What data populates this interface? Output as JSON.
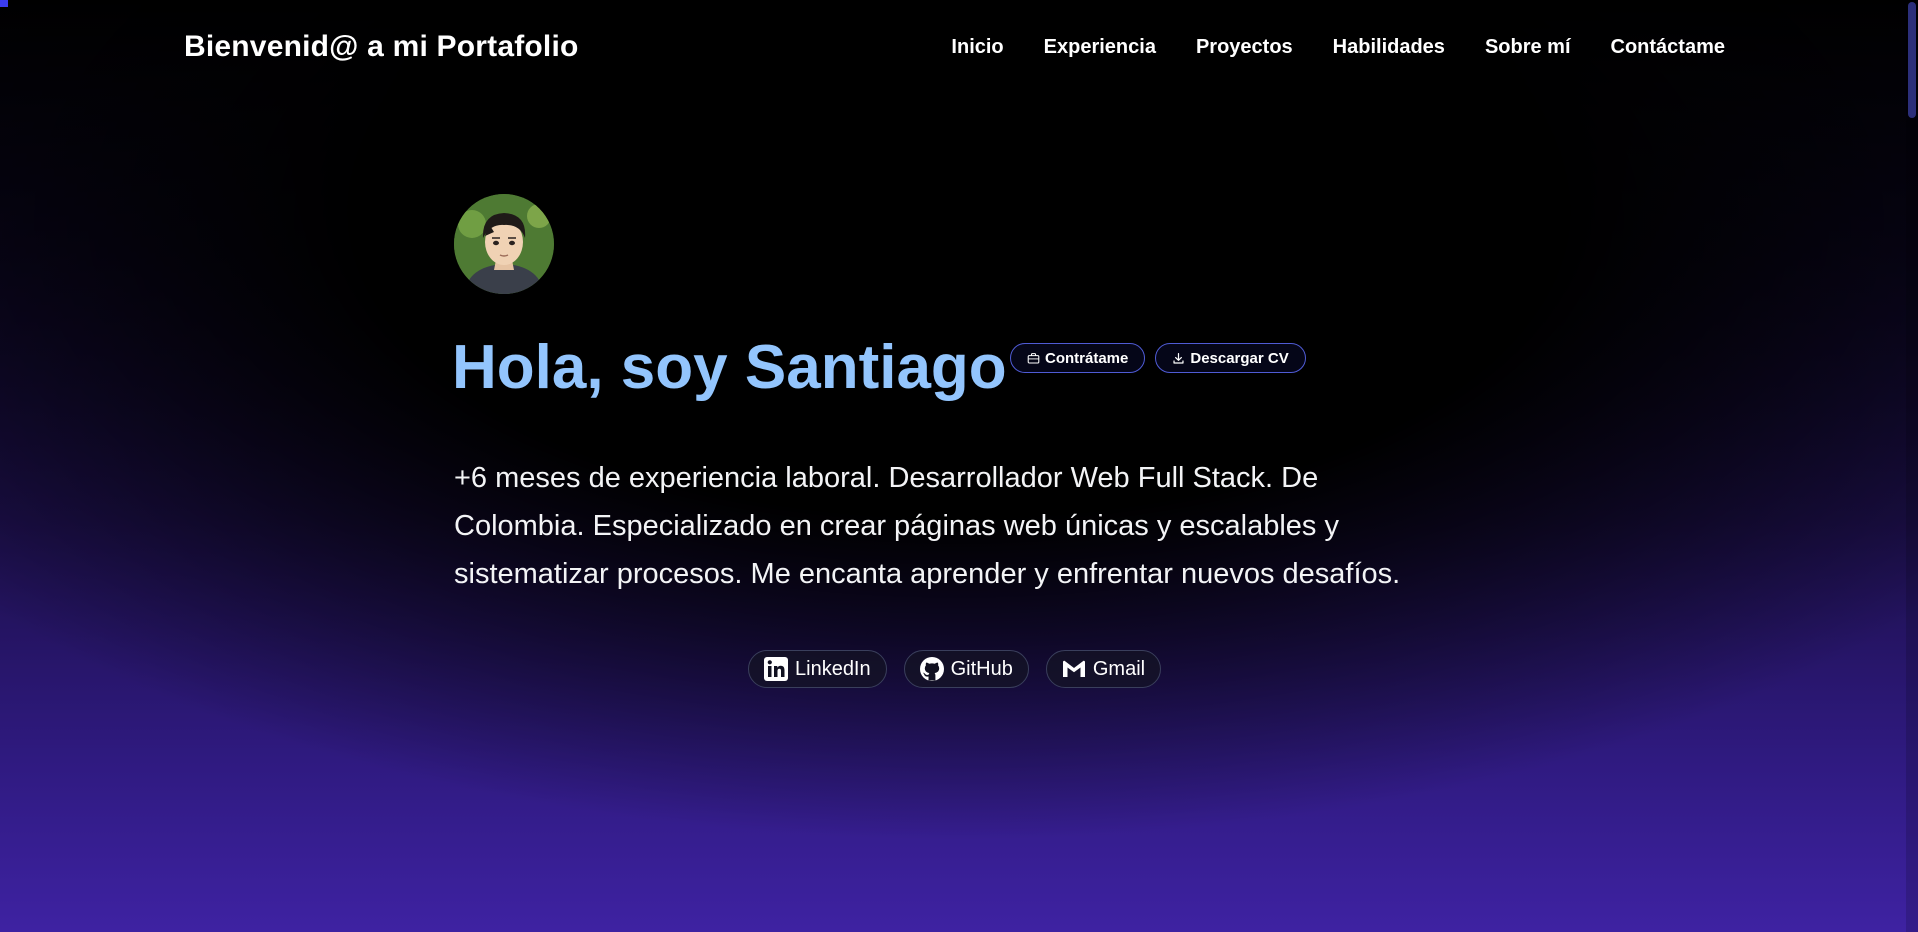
{
  "header": {
    "title": "Bienvenid@ a mi Portafolio",
    "nav": [
      "Inicio",
      "Experiencia",
      "Proyectos",
      "Habilidades",
      "Sobre mí",
      "Contáctame"
    ]
  },
  "hero": {
    "avatar_icon": "profile-photo",
    "title": "Hola, soy Santiago",
    "buttons": {
      "hire_label": "Contrátame",
      "hire_icon": "briefcase-icon",
      "cv_label": "Descargar CV",
      "cv_icon": "download-icon"
    },
    "bio": "+6 meses de experiencia laboral. Desarrollador Web Full Stack. De Colombia. Especializado en crear páginas web únicas y escalables y sistematizar procesos. Me encanta aprender y enfrentar nuevos desafíos."
  },
  "social": [
    {
      "label": "LinkedIn",
      "icon": "linkedin-icon"
    },
    {
      "label": "GitHub",
      "icon": "github-icon"
    },
    {
      "label": "Gmail",
      "icon": "gmail-icon"
    }
  ],
  "colors": {
    "title_accent": "#93c5fd",
    "pill_border": "#4f5bd5",
    "background_bottom": "#3e22a2"
  }
}
